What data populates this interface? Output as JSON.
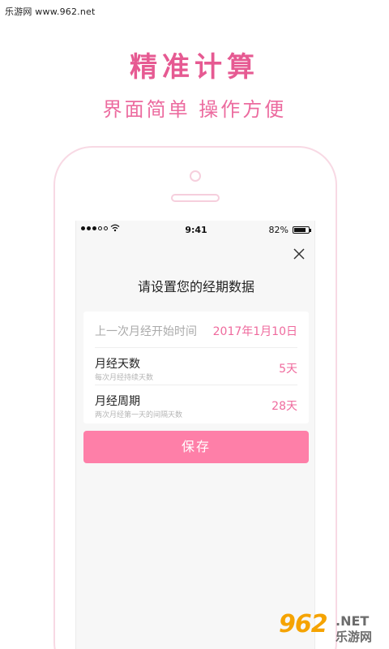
{
  "watermark": "乐游网 www.962.net",
  "headline": {
    "title": "精准计算",
    "subtitle": "界面简单 操作方便"
  },
  "statusbar": {
    "time": "9:41",
    "battery": "82%",
    "battery_level": 0.82
  },
  "dialog": {
    "close_icon": "close-icon",
    "title": "请设置您的经期数据",
    "rows": [
      {
        "label": "上一次月经开始时间",
        "value": "2017年1月10日"
      },
      {
        "label": "月经天数",
        "sub": "每次月经持续天数",
        "value": "5天"
      },
      {
        "label": "月经周期",
        "sub": "两次月经第一天的间隔天数",
        "value": "28天"
      }
    ],
    "save_label": "保存"
  },
  "logo": {
    "number": "962",
    "net": ".NET",
    "cn": "乐游网"
  },
  "colors": {
    "accent": "#e65a92",
    "button": "#fe7fa8",
    "value": "#ef6a9d"
  }
}
